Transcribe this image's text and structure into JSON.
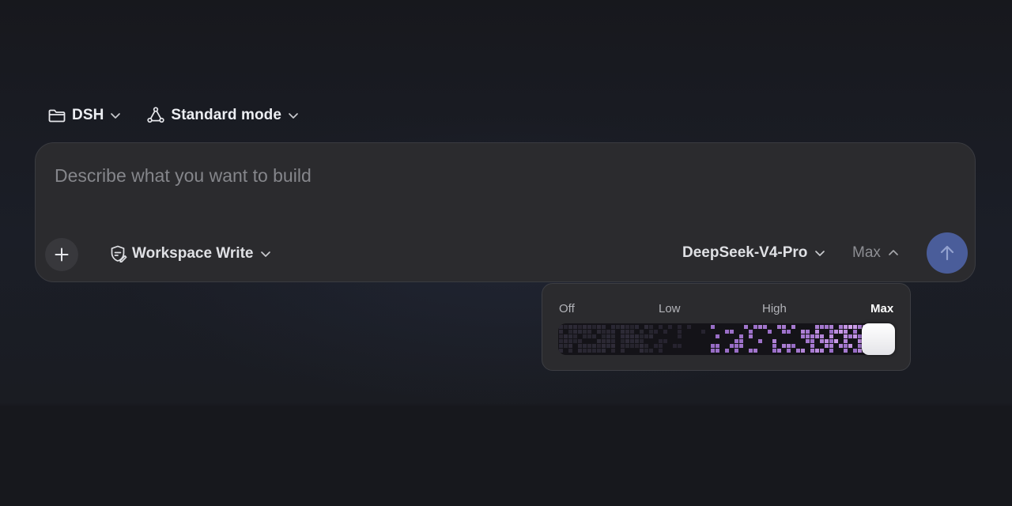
{
  "topbar": {
    "folder": {
      "label": "DSH",
      "icon": "folder-icon"
    },
    "mode": {
      "label": "Standard mode",
      "icon": "mode-nodes-icon"
    }
  },
  "composer": {
    "placeholder": "Describe what you want to build",
    "value": "",
    "permission": {
      "label": "Workspace Write",
      "icon": "shield-pen-icon"
    },
    "model": {
      "label": "DeepSeek-V4-Pro"
    },
    "effort": {
      "label": "Max"
    },
    "add_icon": "plus-icon",
    "send_icon": "arrow-up-icon"
  },
  "effort_popover": {
    "levels": [
      "Off",
      "Low",
      "High",
      "Max"
    ],
    "selected": "Max",
    "selected_index": 3
  },
  "colors": {
    "background": "#17181d",
    "composer_bg": "#2b2b2e",
    "send_button": "#4a5d9a",
    "slider_accent": "#9b6fd8"
  }
}
